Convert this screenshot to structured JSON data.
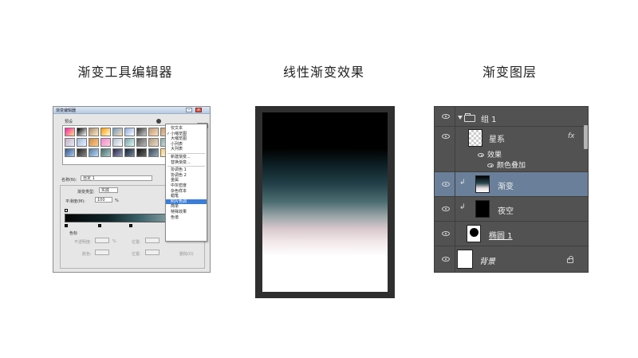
{
  "captions": {
    "gradient_editor": "渐变工具编辑器",
    "linear_effect": "线性渐变效果",
    "layers": "渐变图层"
  },
  "gradient_editor": {
    "title": "渐变编辑器",
    "presets_label": "预设",
    "name_label": "名称(N):",
    "name_value": "自定 1",
    "gradient_type_label": "渐变类型:",
    "gradient_type_value": "实底",
    "smoothness_label": "平滑度(M):",
    "smoothness_value": "100",
    "percent": "%",
    "color_stops_label": "色标",
    "opacity_label": "不透明度:",
    "position_label": "位置:",
    "color_label": "颜色:",
    "delete_label": "删除(D)",
    "menu_items": [
      {
        "label": "仅文本",
        "checked": false
      },
      {
        "label": "小缩览图",
        "checked": true
      },
      {
        "label": "大缩览图",
        "checked": false
      },
      {
        "label": "小列表",
        "checked": false
      },
      {
        "label": "大列表",
        "checked": false
      },
      {
        "sep": true
      },
      {
        "label": "新建渐变...",
        "checked": false
      },
      {
        "label": "替换渐变...",
        "checked": false
      },
      {
        "sep": true
      },
      {
        "label": "协调色 1",
        "checked": false
      },
      {
        "label": "协调色 2",
        "checked": false
      },
      {
        "label": "金属",
        "checked": false
      },
      {
        "label": "中灰密度",
        "checked": false
      },
      {
        "label": "杂色样本",
        "checked": false
      },
      {
        "label": "蜡笔",
        "checked": false
      },
      {
        "label": "照片色调",
        "checked": false,
        "highlight": true
      },
      {
        "label": "简单",
        "checked": false
      },
      {
        "label": "特殊效果",
        "checked": false
      },
      {
        "label": "色谱",
        "checked": false
      }
    ],
    "preset_swatches": [
      "linear-gradient(135deg,#f2a,#fd8)",
      "linear-gradient(135deg,#000,#fff)",
      "linear-gradient(135deg,#a86,#fec)",
      "linear-gradient(135deg,#f90,#ffd)",
      "linear-gradient(135deg,#69c,#fda)",
      "linear-gradient(135deg,#8ad,#fff)",
      "linear-gradient(135deg,#333,#ccc)",
      "linear-gradient(135deg,#b97,#fdb)",
      "linear-gradient(135deg,#c96,#edc)",
      "linear-gradient(135deg,#987,#eee)",
      "linear-gradient(135deg,#cab,#def)",
      "linear-gradient(135deg,#9bd,#eef)",
      "linear-gradient(135deg,#c84,#fc8)",
      "linear-gradient(135deg,#e8c,#fcd)",
      "linear-gradient(135deg,#abc,#fff)",
      "linear-gradient(135deg,#79a,#dfe)",
      "linear-gradient(135deg,#555,#bbb)",
      "linear-gradient(135deg,#a97,#edc)",
      "linear-gradient(135deg,#8aa,#dee)",
      "linear-gradient(135deg,#667,#ccd)",
      "linear-gradient(135deg,#358,#ace)",
      "linear-gradient(135deg,#222,#888)",
      "linear-gradient(135deg,#579,#bdf)",
      "linear-gradient(135deg,#466,#acc)",
      "linear-gradient(135deg,#224,#99b)",
      "linear-gradient(135deg,#123,#789)",
      "linear-gradient(135deg,#111,#666)",
      "linear-gradient(135deg,#345,#9ab)",
      "linear-gradient(135deg,#fc6,#fff)",
      "linear-gradient(135deg,#fa8,#fff)"
    ]
  },
  "effect": {
    "gradient_stops": [
      "#000000",
      "#234048",
      "#d9c9cd",
      "#ffffff"
    ]
  },
  "layers": {
    "group_name": "组 1",
    "starry_name": "星系",
    "fx_label": "fx",
    "effects_label": "效果",
    "color_overlay_label": "颜色叠加",
    "gradient_layer_name": "渐变",
    "night_sky_name": "夜空",
    "ellipse_name": "椭圆 1",
    "background_name": "背景",
    "selected_color": "#6a7f99",
    "panel_color": "#525252"
  }
}
